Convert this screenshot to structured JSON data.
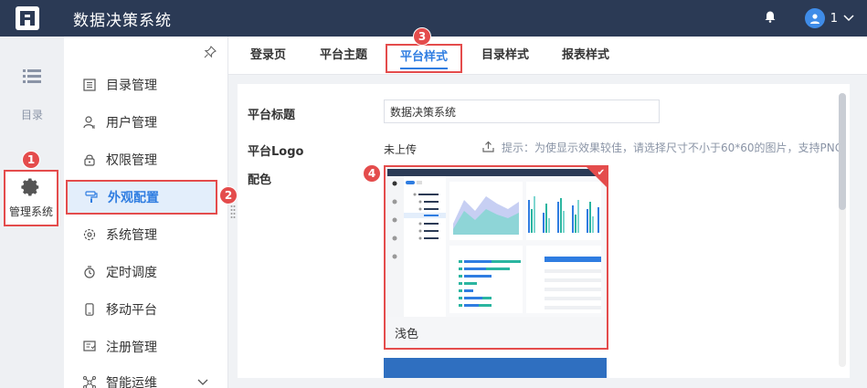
{
  "header": {
    "title": "数据决策系统",
    "user_label": "1"
  },
  "rail": {
    "catalog_label": "目录",
    "manage_label": "管理系统"
  },
  "menu": {
    "items": [
      {
        "label": "目录管理",
        "icon": "catalog-icon"
      },
      {
        "label": "用户管理",
        "icon": "user-icon"
      },
      {
        "label": "权限管理",
        "icon": "lock-icon"
      },
      {
        "label": "外观配置",
        "icon": "paint-roller-icon"
      },
      {
        "label": "系统管理",
        "icon": "gear-icon"
      },
      {
        "label": "定时调度",
        "icon": "stopwatch-icon"
      },
      {
        "label": "移动平台",
        "icon": "mobile-icon"
      },
      {
        "label": "注册管理",
        "icon": "register-icon"
      },
      {
        "label": "智能运维",
        "icon": "network-icon"
      }
    ],
    "active_index": 3
  },
  "tabs": [
    {
      "label": "登录页"
    },
    {
      "label": "平台主题"
    },
    {
      "label": "平台样式"
    },
    {
      "label": "目录样式"
    },
    {
      "label": "报表样式"
    }
  ],
  "form": {
    "platform_title_label": "平台标题",
    "platform_title_value": "数据决策系统",
    "logo_label": "平台Logo",
    "logo_status": "未上传",
    "upload_hint": "提示：为使显示效果较佳，请选择尺寸不小于60*60的图片，支持PNG",
    "color_label": "配色",
    "theme_name": "浅色"
  },
  "badges": {
    "b1": "1",
    "b2": "2",
    "b3": "3",
    "b4": "4"
  },
  "colors": {
    "topbar": "#2b3a55",
    "accent": "#2f7de1",
    "highlight_border": "#e44c4c",
    "active_bg": "#e3eefb"
  }
}
